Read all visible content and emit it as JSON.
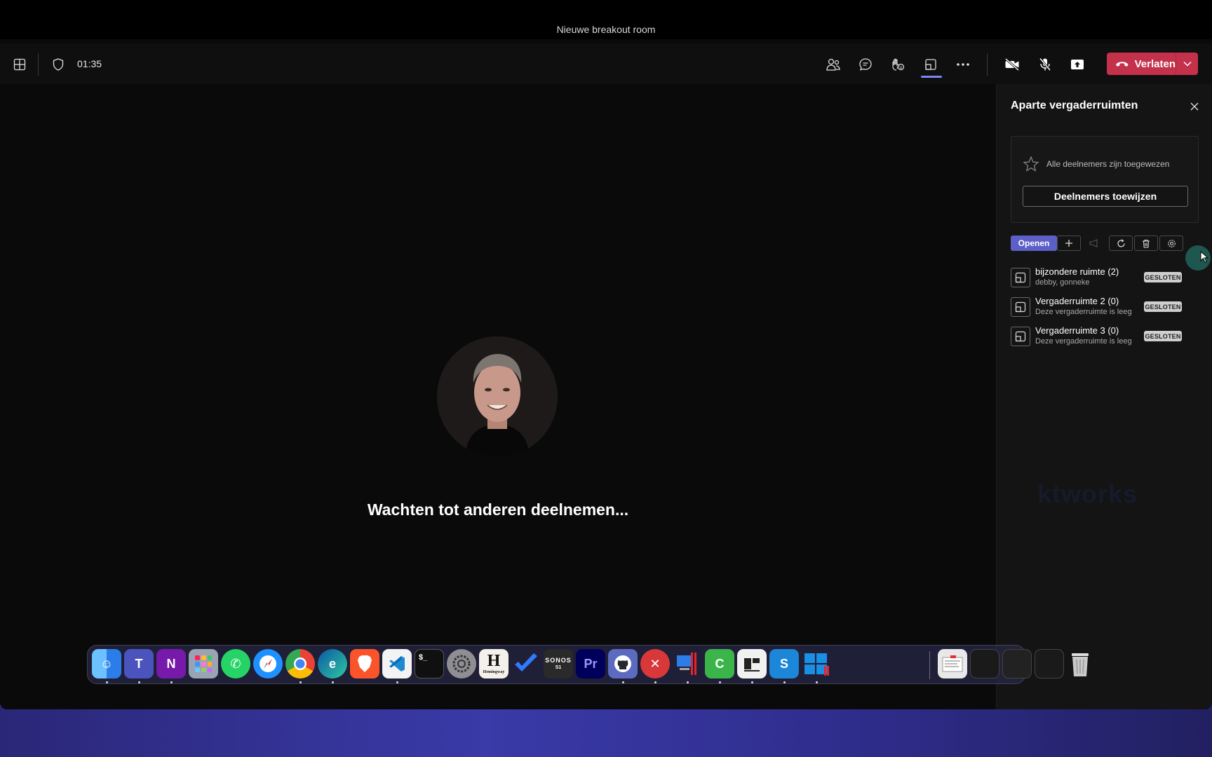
{
  "window": {
    "title": "Nieuwe breakout room"
  },
  "toolbar": {
    "timer": "01:35",
    "leave_label": "Verlaten",
    "accent": "#c4314b"
  },
  "stage": {
    "waiting_text": "Wachten tot anderen deelnemen..."
  },
  "panel": {
    "title": "Aparte vergaderruimten",
    "assign_status": "Alle deelnemers zijn toegewezen",
    "assign_button": "Deelnemers toewijzen",
    "open_button": "Openen",
    "rooms": [
      {
        "name": "bijzondere ruimte (2)",
        "sub": "debby, gonneke",
        "badge": "GESLOTEN"
      },
      {
        "name": "Vergaderruimte 2 (0)",
        "sub": "Deze vergaderruimte is leeg",
        "badge": "GESLOTEN"
      },
      {
        "name": "Vergaderruimte 3 (0)",
        "sub": "Deze vergaderruimte is leeg",
        "badge": "GESLOTEN"
      }
    ],
    "watermark": "ktworks"
  },
  "dock": {
    "apps": [
      "finder-icon",
      "teams-icon",
      "onenote-icon",
      "launchpad-icon",
      "whatsapp-icon",
      "safari-icon",
      "chrome-icon",
      "edge-icon",
      "brave-icon",
      "vscode-icon",
      "terminal-icon",
      "system-settings-icon",
      "hemingway-icon",
      "todo-icon",
      "sonos-icon",
      "premiere-icon",
      "github-icon",
      "remote-desktop-icon",
      "parallels-icon",
      "camtasia-icon",
      "app-icon",
      "snagit-icon",
      "windows-icon",
      "preview-icon",
      "window-thumb-icon",
      "window-thumb-icon",
      "window-thumb-icon",
      "trash-icon"
    ],
    "labels": {
      "hemingway": "H",
      "hemingway_sub": "Hemingway",
      "sonos": "SONOS",
      "sonos_sub": "S1",
      "premiere": "Pr"
    }
  }
}
